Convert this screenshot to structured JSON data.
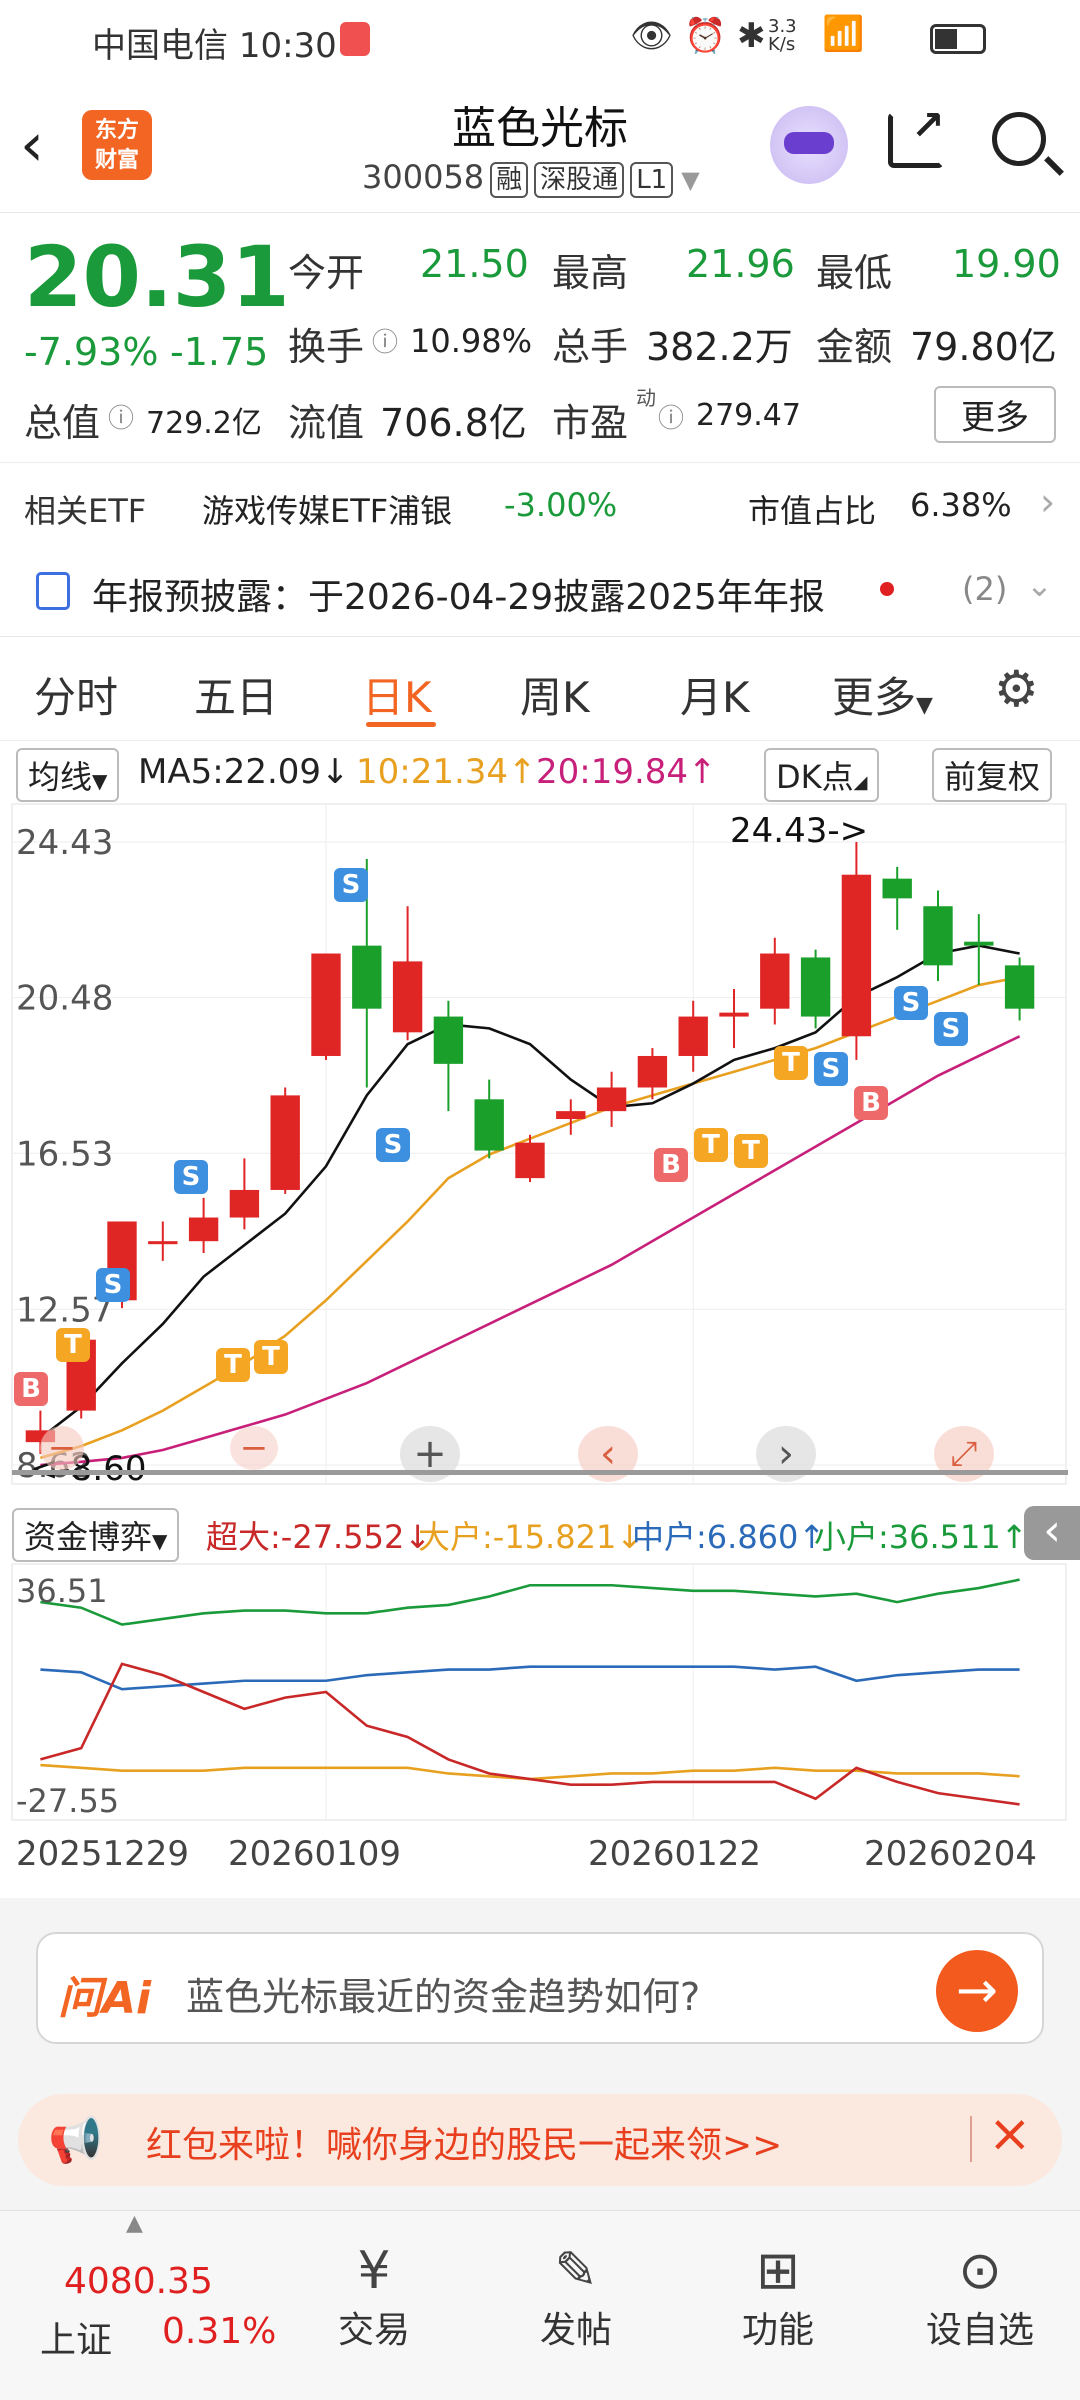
{
  "status_bar": {
    "carrier": "中国电信",
    "time": "10:30",
    "net_speed": "3.3 K/s"
  },
  "header": {
    "title": "蓝色光标",
    "code": "300058",
    "badges": [
      "融",
      "深股通",
      "L1"
    ]
  },
  "quote": {
    "price": "20.31",
    "pct": "-7.93%",
    "chg": "-1.75",
    "open_label": "今开",
    "open": "21.50",
    "high_label": "最高",
    "high": "21.96",
    "low_label": "最低",
    "low": "19.90",
    "turnover_label": "换手",
    "turnover": "10.98%",
    "vol_label": "总手",
    "vol": "382.2万",
    "amount_label": "金额",
    "amount": "79.80亿",
    "mcap_label": "总值",
    "mcap": "729.2亿",
    "fcap_label": "流值",
    "fcap": "706.8亿",
    "pe_label": "市盈",
    "pe_sup": "动",
    "pe": "279.47",
    "more": "更多"
  },
  "etf": {
    "label": "相关ETF",
    "name": "游戏传媒ETF浦银",
    "pct": "-3.00%",
    "share_label": "市值占比",
    "share": "6.38%"
  },
  "notice": {
    "text": "年报预披露：于2026-04-29披露2025年年报",
    "count": "(2)"
  },
  "tabs": [
    "分时",
    "五日",
    "日K",
    "周K",
    "月K",
    "更多"
  ],
  "active_tab": 2,
  "ma_bar": {
    "selector": "均线",
    "ma5": "MA5:22.09↓",
    "ma10": "10:21.34↑",
    "ma20": "20:19.84↑",
    "dk": "DK点",
    "adj": "前复权"
  },
  "kline": {
    "y_labels": [
      "24.43",
      "20.48",
      "16.53",
      "12.57",
      "8.62"
    ],
    "high_mark": "24.43->",
    "low_mark": "<-8.60"
  },
  "fund": {
    "selector": "资金博弈",
    "super": "超大:-27.552↓",
    "big": "大户:-15.821↓",
    "mid": "中户:6.860↑",
    "small": "小户:36.511↑",
    "y_top": "36.51",
    "y_bottom": "-27.55",
    "dates": [
      "20251229",
      "20260109",
      "20260122",
      "20260204"
    ]
  },
  "ai": {
    "logo": "问Ai",
    "prompt": "蓝色光标最近的资金趋势如何?"
  },
  "promo": {
    "text": "红包来啦！喊你身边的股民一起来领>>"
  },
  "bottom": {
    "index_value": "4080.35",
    "index_name": "上证",
    "index_pct": "0.31%",
    "items": [
      "交易",
      "发帖",
      "功能",
      "设自选"
    ]
  },
  "chart_data": {
    "type": "candlestick",
    "ylim": [
      8.62,
      24.43
    ],
    "y_ticks": [
      24.43,
      20.48,
      16.53,
      12.57,
      8.62
    ],
    "candles": [
      {
        "o": 9.2,
        "c": 9.5,
        "h": 10.0,
        "l": 8.9
      },
      {
        "o": 10.0,
        "c": 11.8,
        "h": 12.0,
        "l": 9.8
      },
      {
        "o": 12.8,
        "c": 14.8,
        "h": 14.8,
        "l": 12.6
      },
      {
        "o": 14.3,
        "c": 14.3,
        "h": 14.8,
        "l": 13.8
      },
      {
        "o": 14.3,
        "c": 14.9,
        "h": 15.4,
        "l": 14.0
      },
      {
        "o": 14.9,
        "c": 15.6,
        "h": 16.4,
        "l": 14.6
      },
      {
        "o": 15.6,
        "c": 18.0,
        "h": 18.2,
        "l": 15.5
      },
      {
        "o": 19.0,
        "c": 21.6,
        "h": 21.6,
        "l": 18.9
      },
      {
        "o": 21.8,
        "c": 20.2,
        "h": 24.0,
        "l": 18.2
      },
      {
        "o": 19.6,
        "c": 21.4,
        "h": 22.8,
        "l": 19.4
      },
      {
        "o": 20.0,
        "c": 18.8,
        "h": 20.4,
        "l": 17.6
      },
      {
        "o": 17.9,
        "c": 16.6,
        "h": 18.4,
        "l": 16.4
      },
      {
        "o": 15.9,
        "c": 16.8,
        "h": 17.0,
        "l": 15.8
      },
      {
        "o": 17.4,
        "c": 17.6,
        "h": 17.9,
        "l": 17.0
      },
      {
        "o": 17.6,
        "c": 18.2,
        "h": 18.6,
        "l": 17.2
      },
      {
        "o": 18.2,
        "c": 19.0,
        "h": 19.2,
        "l": 17.9
      },
      {
        "o": 19.0,
        "c": 20.0,
        "h": 20.4,
        "l": 18.6
      },
      {
        "o": 20.0,
        "c": 20.1,
        "h": 20.7,
        "l": 19.2
      },
      {
        "o": 20.2,
        "c": 21.6,
        "h": 22.0,
        "l": 19.8
      },
      {
        "o": 21.5,
        "c": 20.0,
        "h": 21.7,
        "l": 19.7
      },
      {
        "o": 19.5,
        "c": 23.6,
        "h": 24.43,
        "l": 18.9
      },
      {
        "o": 23.5,
        "c": 23.0,
        "h": 23.8,
        "l": 22.2
      },
      {
        "o": 22.8,
        "c": 21.3,
        "h": 23.2,
        "l": 20.9
      },
      {
        "o": 21.9,
        "c": 21.8,
        "h": 22.6,
        "l": 20.8
      },
      {
        "o": 21.3,
        "c": 20.2,
        "h": 21.5,
        "l": 19.9
      }
    ],
    "ma5": [
      9.3,
      10.1,
      11.2,
      12.2,
      13.4,
      14.2,
      15.0,
      16.2,
      18.0,
      19.3,
      19.8,
      19.7,
      19.3,
      18.4,
      17.7,
      17.8,
      18.3,
      18.9,
      19.2,
      19.6,
      20.5,
      21.0,
      21.6,
      21.8,
      21.6
    ],
    "ma10": [
      8.8,
      9.1,
      9.5,
      10.0,
      10.6,
      11.2,
      11.9,
      12.8,
      13.8,
      14.8,
      15.9,
      16.5,
      16.9,
      17.3,
      17.7,
      18.0,
      18.3,
      18.6,
      18.9,
      19.2,
      19.6,
      20.0,
      20.4,
      20.8,
      21.0
    ],
    "ma20": [
      8.62,
      8.7,
      8.8,
      9.0,
      9.3,
      9.6,
      9.9,
      10.3,
      10.7,
      11.2,
      11.7,
      12.2,
      12.7,
      13.2,
      13.7,
      14.3,
      14.9,
      15.5,
      16.1,
      16.7,
      17.3,
      17.9,
      18.5,
      19.0,
      19.5
    ],
    "fund_series": {
      "small": [
        34,
        32,
        26,
        28,
        30,
        31,
        31,
        30,
        30,
        32,
        33,
        36,
        40,
        40,
        40,
        39,
        38,
        38,
        37,
        36,
        37,
        34,
        37,
        39,
        42
      ],
      "mid": [
        10,
        9,
        3,
        4,
        5,
        6,
        6,
        6,
        8,
        9,
        10,
        10,
        11,
        11,
        11,
        11,
        11,
        11,
        10,
        11,
        6,
        8,
        9,
        10,
        10
      ],
      "big": [
        -24,
        -25,
        -26,
        -26,
        -26,
        -25,
        -25,
        -25,
        -25,
        -25,
        -27,
        -28,
        -29,
        -28,
        -27,
        -27,
        -26,
        -26,
        -25,
        -26,
        -26,
        -27,
        -27,
        -27,
        -28
      ],
      "super": [
        -22,
        -18,
        12,
        8,
        2,
        -4,
        0,
        2,
        -10,
        -14,
        -22,
        -27,
        -29,
        -31,
        -31,
        -30,
        -30,
        -30,
        -30,
        -36,
        -25,
        -30,
        -34,
        -36,
        -38
      ]
    }
  }
}
